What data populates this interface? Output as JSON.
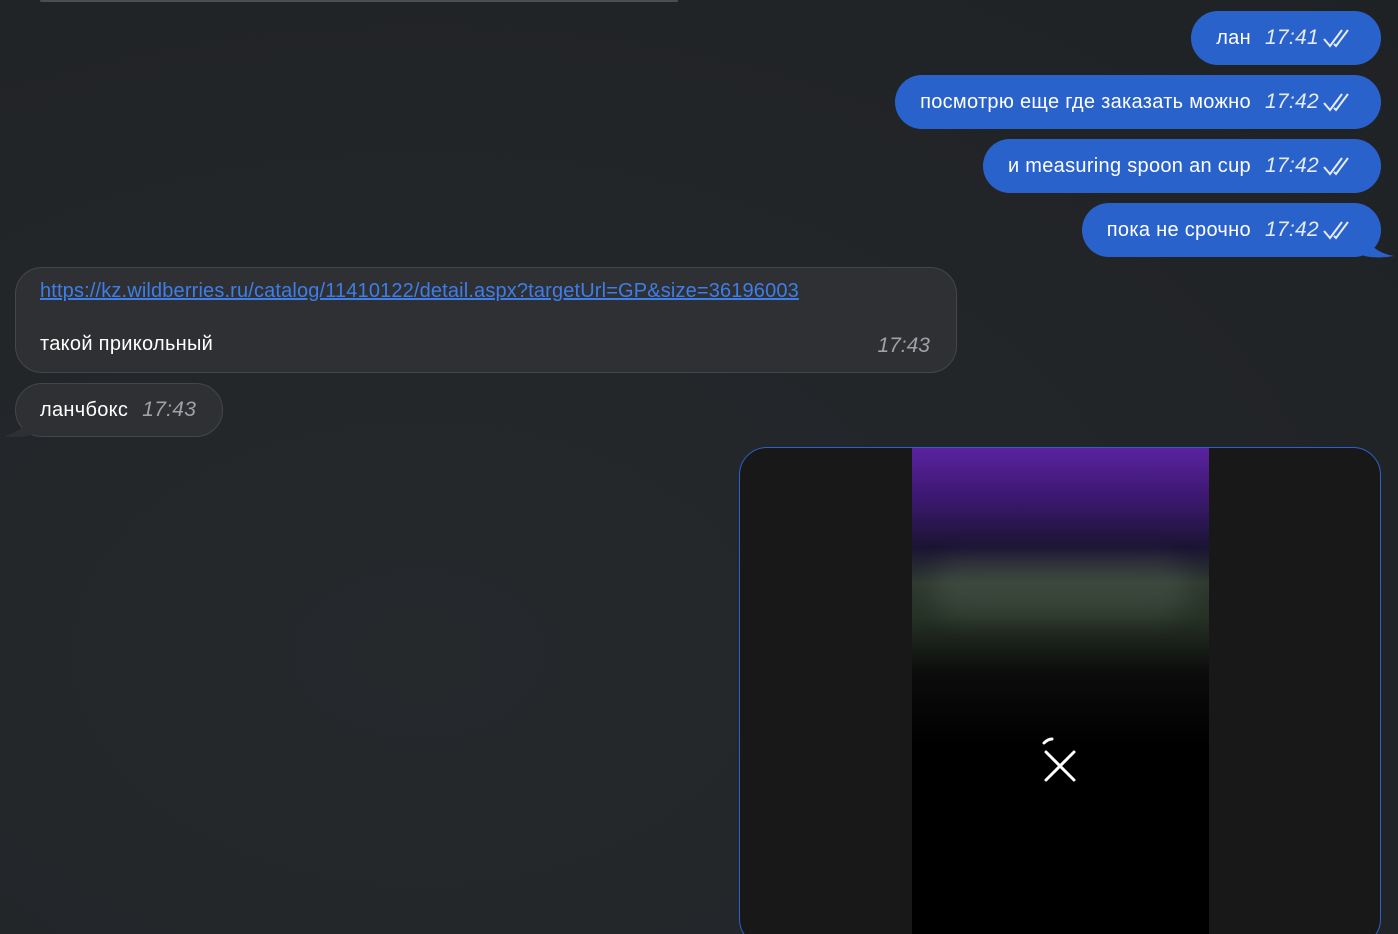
{
  "messages_out": [
    {
      "text": "лан",
      "time": "17:41"
    },
    {
      "text": "посмотрю еще где заказать можно",
      "time": "17:42"
    },
    {
      "text": "и measuring spoon an cup",
      "time": "17:42"
    },
    {
      "text": "пока не срочно",
      "time": "17:42"
    }
  ],
  "link_message": {
    "url": "https://kz.wildberries.ru/catalog/11410122/detail.aspx?targetUrl=GP&size=36196003",
    "text": "такой прикольный",
    "time": "17:43"
  },
  "message_in": {
    "text": "ланчбокс",
    "time": "17:43"
  },
  "colors": {
    "outgoing_bubble": "#2a62cc",
    "incoming_bubble": "#2f3033",
    "background": "#24272a",
    "link": "#3d7ee8"
  },
  "icons": {
    "read_ticks": "double-check-icon",
    "cancel_download": "close-icon"
  }
}
